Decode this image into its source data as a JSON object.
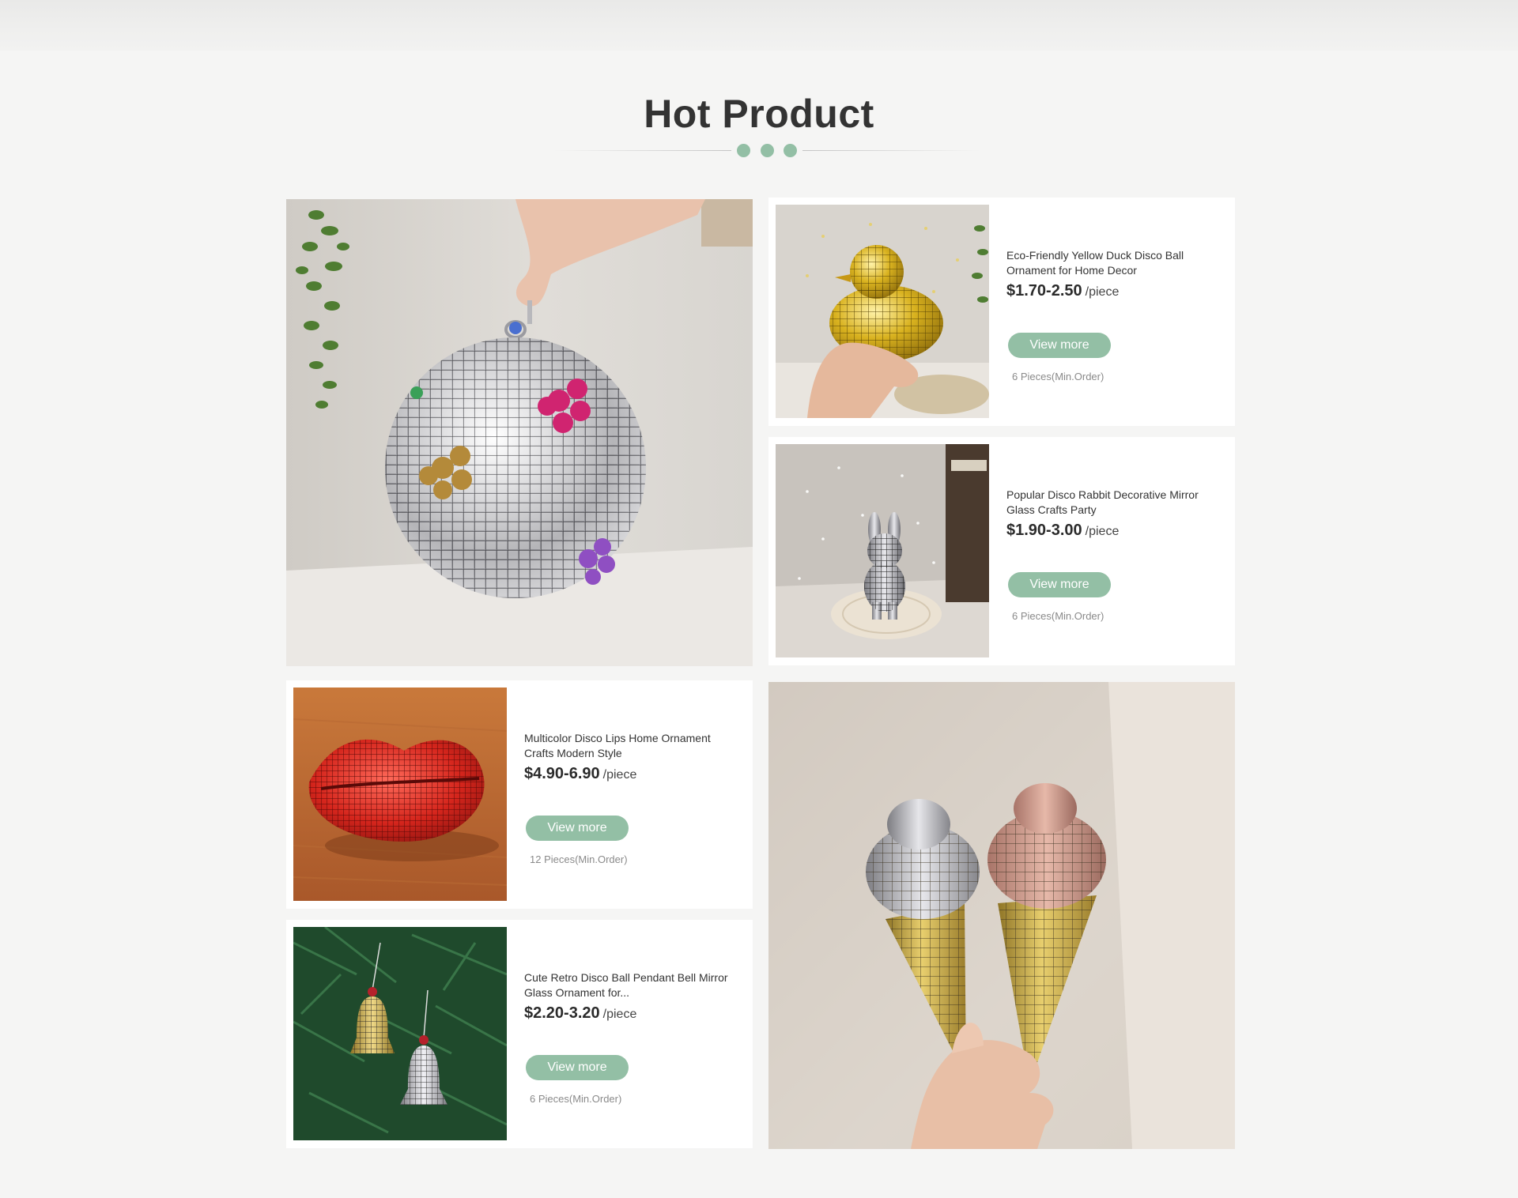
{
  "section": {
    "title": "Hot Product"
  },
  "colors": {
    "accent": "#93bfa5",
    "background": "#f5f5f4",
    "card": "#ffffff",
    "title": "#333333"
  },
  "featured": [
    {
      "image": "silver-disco-ball-with-flowers-photo"
    },
    {
      "image": "disco-ice-cream-cones-photo"
    }
  ],
  "products": [
    {
      "name": "Eco-Friendly Yellow Duck Disco Ball Ornament for Home Decor",
      "price": "$1.70-2.50",
      "unit": "/piece",
      "button": "View more",
      "moq": "6 Pieces(Min.Order)",
      "image": "yellow-duck-disco-ornament-photo"
    },
    {
      "name": "Popular Disco Rabbit Decorative Mirror Glass Crafts Party",
      "price": "$1.90-3.00",
      "unit": "/piece",
      "button": "View more",
      "moq": "6 Pieces(Min.Order)",
      "image": "disco-rabbit-photo"
    },
    {
      "name": "Multicolor Disco Lips Home Ornament Crafts Modern Style",
      "price": "$4.90-6.90",
      "unit": "/piece",
      "button": "View more",
      "moq": "12 Pieces(Min.Order)",
      "image": "red-disco-lips-photo"
    },
    {
      "name": "Cute Retro Disco Ball Pendant Bell Mirror Glass Ornament for...",
      "price": "$2.20-3.20",
      "unit": "/piece",
      "button": "View more",
      "moq": "6 Pieces(Min.Order)",
      "image": "disco-bell-ornaments-photo"
    }
  ]
}
